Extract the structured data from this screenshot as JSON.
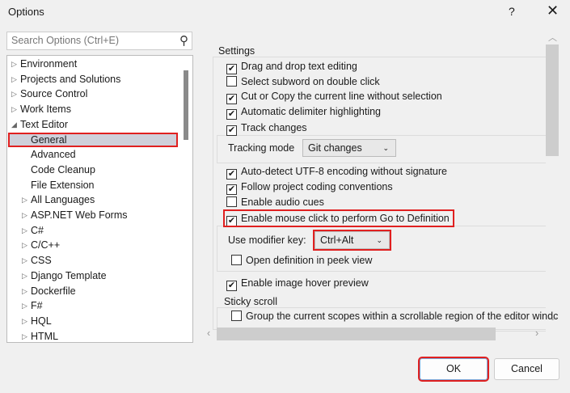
{
  "window": {
    "title": "Options",
    "help": "?",
    "close": "✕"
  },
  "search": {
    "placeholder": "Search Options (Ctrl+E)"
  },
  "tree": [
    {
      "label": "Environment",
      "level": 0,
      "state": "collapsed"
    },
    {
      "label": "Projects and Solutions",
      "level": 0,
      "state": "collapsed"
    },
    {
      "label": "Source Control",
      "level": 0,
      "state": "collapsed"
    },
    {
      "label": "Work Items",
      "level": 0,
      "state": "collapsed"
    },
    {
      "label": "Text Editor",
      "level": 0,
      "state": "expanded"
    },
    {
      "label": "General",
      "level": 1,
      "state": "selected"
    },
    {
      "label": "Advanced",
      "level": 1,
      "state": "leaf"
    },
    {
      "label": "Code Cleanup",
      "level": 1,
      "state": "leaf"
    },
    {
      "label": "File Extension",
      "level": 1,
      "state": "leaf"
    },
    {
      "label": "All Languages",
      "level": 1,
      "state": "collapsed"
    },
    {
      "label": "ASP.NET Web Forms",
      "level": 1,
      "state": "collapsed"
    },
    {
      "label": "C#",
      "level": 1,
      "state": "collapsed"
    },
    {
      "label": "C/C++",
      "level": 1,
      "state": "collapsed"
    },
    {
      "label": "CSS",
      "level": 1,
      "state": "collapsed"
    },
    {
      "label": "Django Template",
      "level": 1,
      "state": "collapsed"
    },
    {
      "label": "Dockerfile",
      "level": 1,
      "state": "collapsed"
    },
    {
      "label": "F#",
      "level": 1,
      "state": "collapsed"
    },
    {
      "label": "HQL",
      "level": 1,
      "state": "collapsed"
    },
    {
      "label": "HTML",
      "level": 1,
      "state": "collapsed"
    }
  ],
  "settings": {
    "group_label": "Settings",
    "options": [
      {
        "label": "Drag and drop text editing",
        "checked": true
      },
      {
        "label": "Select subword on double click",
        "checked": false
      },
      {
        "label": "Cut or Copy the current line without selection",
        "checked": true
      },
      {
        "label": "Automatic delimiter highlighting",
        "checked": true
      },
      {
        "label": "Track changes",
        "checked": true
      },
      {
        "label": "Auto-detect UTF-8 encoding without signature",
        "checked": true
      },
      {
        "label": "Follow project coding conventions",
        "checked": true
      },
      {
        "label": "Enable audio cues",
        "checked": false
      },
      {
        "label": "Enable mouse click to perform Go to Definition",
        "checked": true
      },
      {
        "label": "Open definition in peek view",
        "checked": false
      },
      {
        "label": "Enable image hover preview",
        "checked": true
      },
      {
        "label": "Group the current scopes within a scrollable region of the editor windc",
        "checked": false
      }
    ],
    "tracking_mode_label": "Tracking mode",
    "tracking_mode_value": "Git changes",
    "modifier_label": "Use modifier key:",
    "modifier_value": "Ctrl+Alt",
    "sticky_label": "Sticky scroll"
  },
  "buttons": {
    "ok": "OK",
    "cancel": "Cancel"
  }
}
